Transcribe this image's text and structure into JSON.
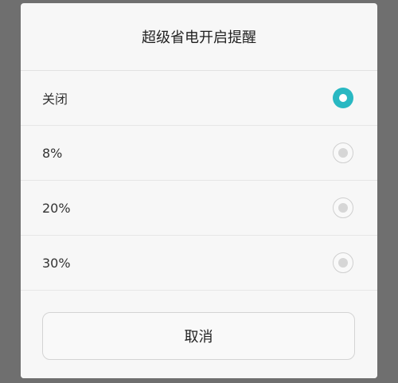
{
  "dialog": {
    "title": "超级省电开启提醒",
    "options": [
      {
        "label": "关闭",
        "selected": true
      },
      {
        "label": "8%",
        "selected": false
      },
      {
        "label": "20%",
        "selected": false
      },
      {
        "label": "30%",
        "selected": false
      }
    ],
    "cancel_label": "取消"
  },
  "colors": {
    "accent": "#29b8c2",
    "overlay": "#6f6f6f"
  }
}
